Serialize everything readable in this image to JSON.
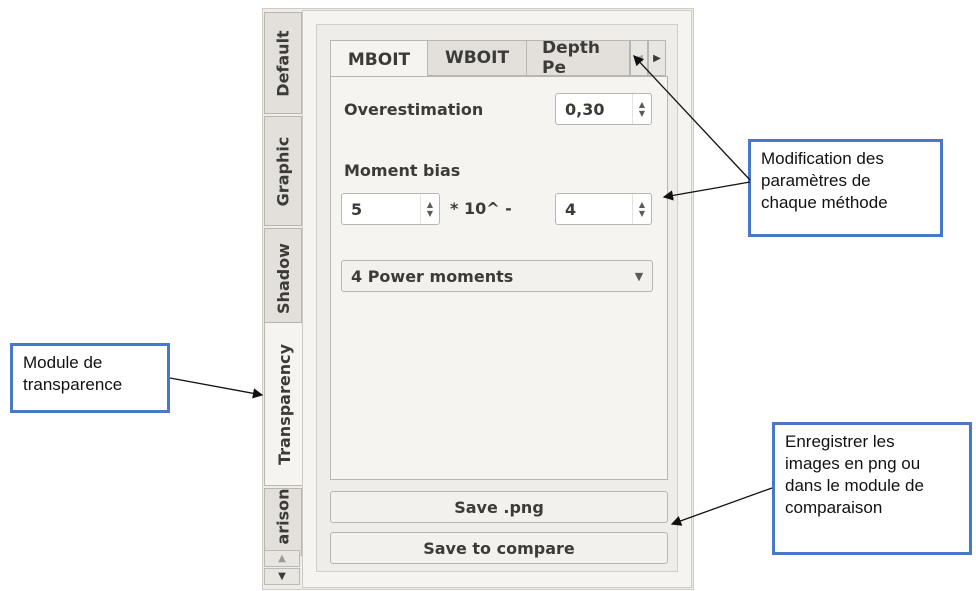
{
  "side_tabs": [
    {
      "label": "Default"
    },
    {
      "label": "Graphic"
    },
    {
      "label": "Shadow"
    },
    {
      "label": "Transparency",
      "active": true
    },
    {
      "label": "arison"
    }
  ],
  "method_tabs": [
    {
      "label": "MBOIT",
      "active": true
    },
    {
      "label": "WBOIT"
    },
    {
      "label": "Depth Pe"
    }
  ],
  "overestimation": {
    "label": "Overestimation",
    "value": "0,30"
  },
  "moment_bias": {
    "label": "Moment bias",
    "mantissa": "5",
    "operator": "* 10^ -",
    "exponent": "4"
  },
  "moments_select": {
    "value": "4 Power moments"
  },
  "buttons": {
    "save_png": "Save .png",
    "save_compare": "Save to compare"
  },
  "annotations": {
    "module": [
      "Module de",
      "transparence"
    ],
    "modification": [
      "Modification des",
      "paramètres de",
      "chaque méthode"
    ],
    "enregistrer": [
      "Enregistrer les",
      "images en png ou",
      "dans le module de",
      "comparaison"
    ]
  },
  "colors": {
    "callout_border": "#4a78c8",
    "panel_bg": "#efedea"
  }
}
